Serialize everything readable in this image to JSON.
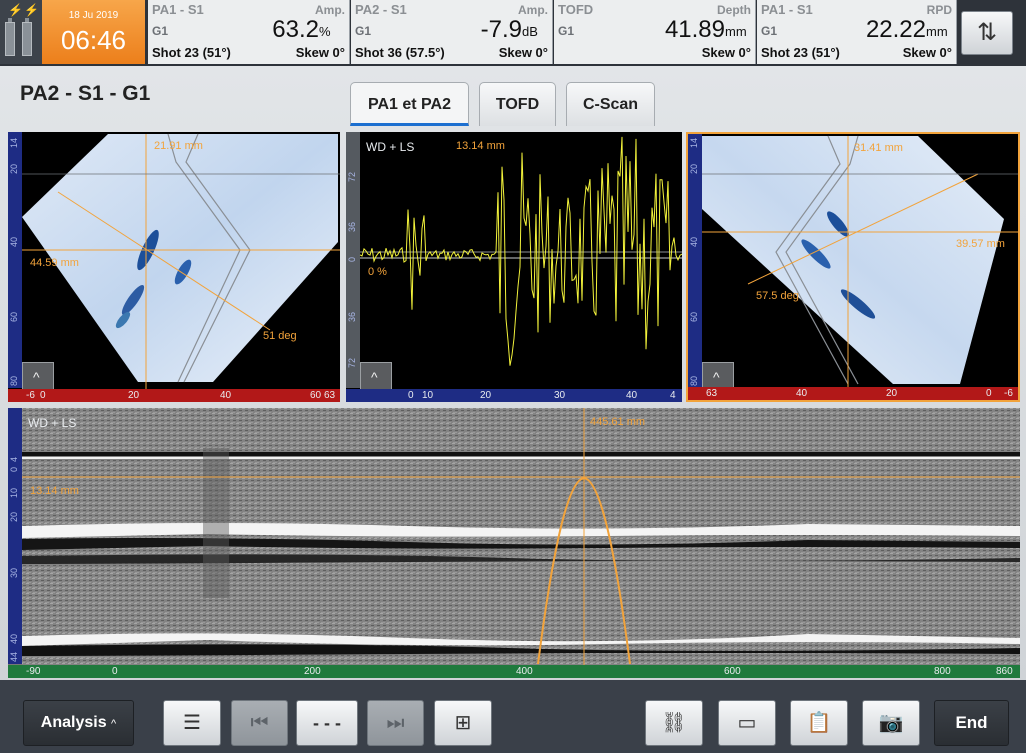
{
  "status": {
    "date": "18 Ju 2019",
    "time": "06:46",
    "readouts": [
      {
        "label": "PA1 - S1",
        "kind": "Amp.",
        "group": "G1",
        "value": "63.2",
        "unit": "%",
        "shot": "Shot 23 (51°)",
        "skew": "Skew 0°"
      },
      {
        "label": "PA2 - S1",
        "kind": "Amp.",
        "group": "G1",
        "value": "-7.9",
        "unit": "dB",
        "shot": "Shot 36 (57.5°)",
        "skew": "Skew 0°"
      },
      {
        "label": "TOFD",
        "kind": "Depth",
        "group": "G1",
        "value": "41.89",
        "unit": "mm",
        "shot": "",
        "skew": "Skew 0°"
      },
      {
        "label": "PA1 - S1",
        "kind": "RPD",
        "group": "G1",
        "value": "22.22",
        "unit": "mm",
        "shot": "Shot 23 (51°)",
        "skew": "Skew 0°"
      }
    ],
    "swap_icon": "swap-vertical-icon"
  },
  "view": {
    "title": "PA2 - S1 - G1",
    "tabs": [
      {
        "label": "PA1 et PA2",
        "active": true
      },
      {
        "label": "TOFD",
        "active": false
      },
      {
        "label": "C-Scan",
        "active": false
      }
    ]
  },
  "sscan_left": {
    "vticks": [
      "14",
      "20",
      "40",
      "60",
      "80"
    ],
    "hticks": [
      "-6",
      "0",
      "20",
      "40",
      "60",
      "63"
    ],
    "cursor_top": "21.91 mm",
    "cursor_left": "44.59 mm",
    "angle": "51 deg"
  },
  "ascan": {
    "label": "WD + LS",
    "cursor": "13.14 mm",
    "gate": "0 %",
    "vticks": [
      "72",
      "36",
      "0",
      "36",
      "72"
    ],
    "hticks": [
      "0",
      "10",
      "20",
      "30",
      "40",
      "4"
    ]
  },
  "sscan_right": {
    "vticks": [
      "14",
      "20",
      "40",
      "60",
      "80"
    ],
    "hticks": [
      "63",
      "40",
      "20",
      "0",
      "-6"
    ],
    "cursor_top": "31.41 mm",
    "cursor_right": "39.57 mm",
    "angle": "57.5 deg"
  },
  "bscan": {
    "label": "WD + LS",
    "cursor_index": "445.61 mm",
    "cursor_depth": "13.14 mm",
    "vticks": [
      "4",
      "0",
      "10",
      "20",
      "30",
      "40",
      "44"
    ],
    "hticks": [
      "-90",
      "0",
      "200",
      "400",
      "600",
      "800",
      "860"
    ]
  },
  "toolbar": {
    "analysis_label": "Analysis",
    "analysis_caret": "^",
    "counter_label": "- - -",
    "end_label": "End",
    "icons": {
      "report": "report-list-icon",
      "prev": "skip-previous-icon",
      "next": "skip-next-icon",
      "add_indication": "add-selection-icon",
      "link": "unlink-icon",
      "layout": "layout-icon",
      "clipboard": "clipboard-icon",
      "camera": "camera-icon"
    }
  },
  "colors": {
    "accent": "#ec7f1b",
    "cursor": "#f2a33b",
    "ruler_blue": "#1e2c84",
    "ruler_red": "#b21818",
    "ruler_green": "#1f7a3d",
    "signal": "#f2f23b"
  }
}
